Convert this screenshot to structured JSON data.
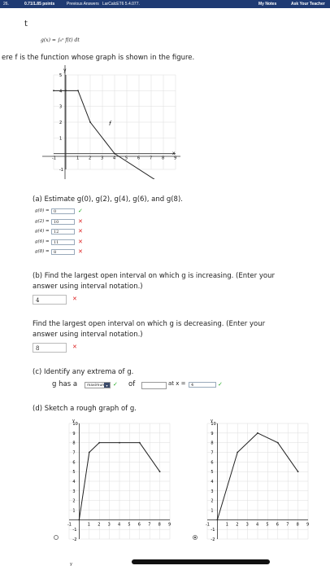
{
  "topbar": {
    "number": "26.",
    "points": "0.71/1.85 points",
    "previous": "Previous Answers",
    "code": "LarCalcET6 5.4.077.",
    "my_notes": "My Notes",
    "ask": "Ask Your Teacher"
  },
  "problem": {
    "t_letter": "t",
    "formula": "g(x) = ∫₀ˣ f(t) dt",
    "intro": "ere f is the function whose graph is shown in the figure."
  },
  "chart_data": [
    {
      "type": "line",
      "name": "f",
      "x": [
        -1,
        0,
        1,
        2,
        4,
        8
      ],
      "y": [
        4,
        4,
        4,
        2,
        0,
        -2
      ],
      "xlim": [
        -1,
        9
      ],
      "ylim": [
        -1,
        5
      ],
      "xlabel": "x",
      "ylabel": "y",
      "x_ticks": [
        "-1",
        "1",
        "2",
        "3",
        "4",
        "5",
        "6",
        "7",
        "8",
        "9"
      ],
      "y_ticks": [
        "5",
        "4",
        "3",
        "2",
        "1",
        "-1"
      ]
    },
    {
      "type": "line",
      "x": [
        0,
        1,
        2,
        4,
        6,
        8
      ],
      "y": [
        0,
        7,
        8,
        8,
        8,
        5
      ],
      "xlim": [
        -1,
        9
      ],
      "ylim": [
        -2,
        10
      ],
      "xlabel": "",
      "ylabel": "y",
      "x_ticks": [
        "-1",
        "1",
        "2",
        "3",
        "4",
        "5",
        "6",
        "7",
        "8",
        "9"
      ],
      "y_ticks": [
        "10",
        "9",
        "8",
        "7",
        "6",
        "5",
        "4",
        "3",
        "2",
        "1",
        "-1",
        "-2"
      ]
    },
    {
      "type": "line",
      "x": [
        0,
        2,
        4,
        6,
        8
      ],
      "y": [
        0,
        7,
        9,
        8,
        5
      ],
      "xlim": [
        -1,
        9
      ],
      "ylim": [
        -2,
        10
      ],
      "xlabel": "",
      "ylabel": "y",
      "x_ticks": [
        "-1",
        "1",
        "2",
        "3",
        "4",
        "5",
        "6",
        "7",
        "8",
        "9"
      ],
      "y_ticks": [
        "10",
        "9",
        "8",
        "7",
        "6",
        "5",
        "4",
        "3",
        "2",
        "1",
        "-1",
        "-2"
      ]
    }
  ],
  "part_a": {
    "prompt": "(a) Estimate g(0), g(2), g(4), g(6), and g(8).",
    "rows": [
      {
        "label": "g(0) =",
        "value": "0",
        "status": "correct"
      },
      {
        "label": "g(2) =",
        "value": "10",
        "status": "wrong"
      },
      {
        "label": "g(4) =",
        "value": "12",
        "status": "wrong"
      },
      {
        "label": "g(6) =",
        "value": "11",
        "status": "wrong"
      },
      {
        "label": "g(8) =",
        "value": "8",
        "status": "wrong"
      }
    ]
  },
  "part_b": {
    "prompt_inc_1": "(b) Find the largest open interval on which g is increasing. (Enter your",
    "prompt_inc_2": "answer using interval notation.)",
    "inc_value": "4",
    "prompt_dec_1": "Find the largest open interval on which g is decreasing. (Enter your",
    "prompt_dec_2": "answer using interval notation.)",
    "dec_value": "8"
  },
  "part_c": {
    "prompt": "(c) Identify any extrema of g.",
    "has_prefix": "g has a",
    "select_value": "maximum",
    "of_text": "of",
    "of_value": "",
    "at_text": "at x =",
    "at_value": "4"
  },
  "part_d": {
    "prompt": "(d) Sketch a rough graph of g."
  }
}
